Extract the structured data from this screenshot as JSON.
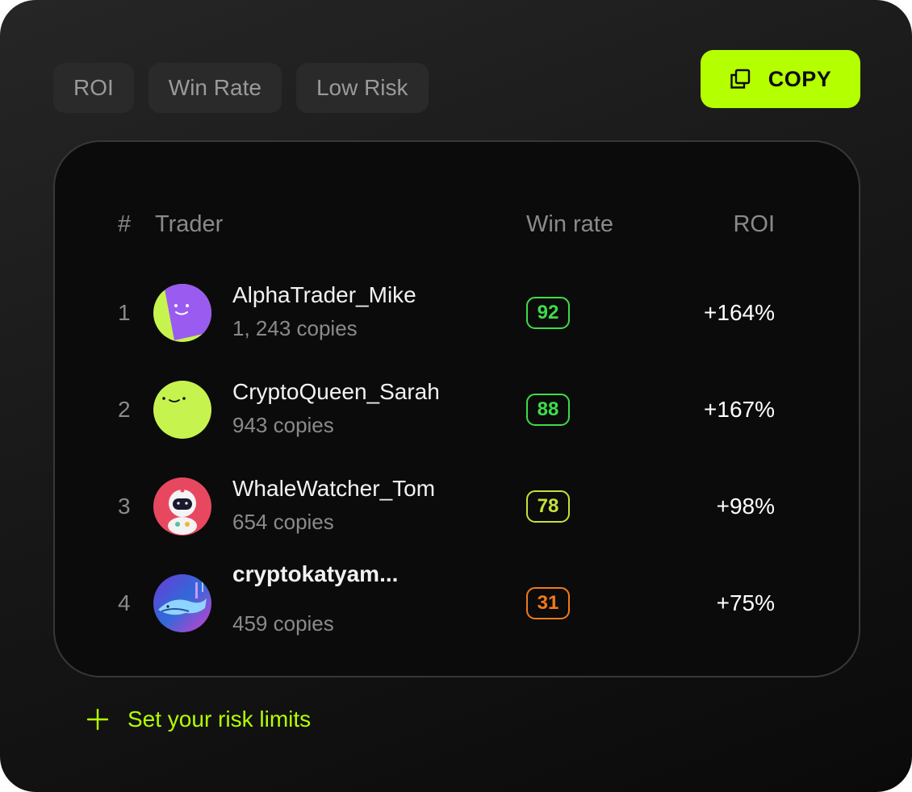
{
  "filters": [
    {
      "label": "ROI"
    },
    {
      "label": "Win Rate"
    },
    {
      "label": "Low Risk"
    }
  ],
  "copy_button": {
    "label": "COPY",
    "icon": "copy-icon"
  },
  "table": {
    "headers": {
      "rank": "#",
      "trader": "Trader",
      "win_rate": "Win rate",
      "roi": "ROI"
    },
    "rows": [
      {
        "rank": "1",
        "name": "AlphaTrader_Mike",
        "copies": "1, 243 copies",
        "win_rate": "92",
        "roi": "+164%",
        "badge_color": "#3ddc4a",
        "avatar": "purple-lime-smiley-avatar"
      },
      {
        "rank": "2",
        "name": "CryptoQueen_Sarah",
        "copies": "943 copies",
        "win_rate": "88",
        "roi": "+167%",
        "badge_color": "#3ddc4a",
        "avatar": "lime-smiley-avatar"
      },
      {
        "rank": "3",
        "name": "WhaleWatcher_Tom",
        "copies": "654 copies",
        "win_rate": "78",
        "roi": "+98%",
        "badge_color": "#c6e03a",
        "avatar": "astronaut-avatar"
      },
      {
        "rank": "4",
        "name": "cryptokatyam...",
        "copies": "459 copies",
        "win_rate": "31",
        "roi": "+75%",
        "badge_color": "#f07a1a",
        "avatar": "whale-avatar"
      }
    ]
  },
  "risk_link": {
    "label": "Set your risk limits",
    "icon": "plus-icon"
  },
  "colors": {
    "accent": "#b4ff00",
    "background": "#181818",
    "panel": "#0b0b0b"
  }
}
